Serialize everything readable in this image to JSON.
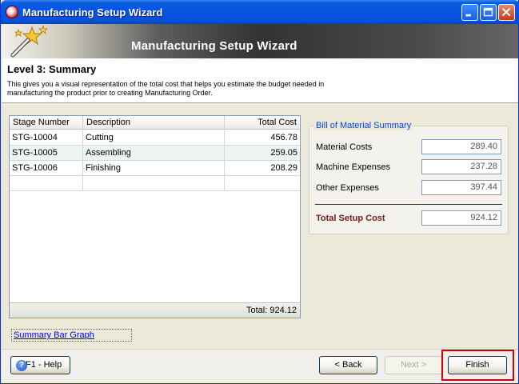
{
  "window": {
    "title": "Manufacturing Setup Wizard"
  },
  "banner": {
    "title": "Manufacturing Setup Wizard"
  },
  "step": {
    "title": "Level 3: Summary",
    "description": "This gives you a visual representation of the total cost that helps you estimate the budget needed in manufacturing the product prior to creating Manufacturing Order."
  },
  "grid": {
    "columns": [
      "Stage Number",
      "Description",
      "Total Cost"
    ],
    "rows": [
      [
        "STG-10004",
        "Cutting",
        "456.78"
      ],
      [
        "STG-10005",
        "Assembling",
        "259.05"
      ],
      [
        "STG-10006",
        "Finishing",
        "208.29"
      ]
    ],
    "total_label": "Total:",
    "total_value": "924.12"
  },
  "bom_summary": {
    "legend": "Bill of Material Summary",
    "material_costs_label": "Material Costs",
    "material_costs_value": "289.40",
    "machine_expenses_label": "Machine Expenses",
    "machine_expenses_value": "237.28",
    "other_expenses_label": "Other Expenses",
    "other_expenses_value": "397.44",
    "total_setup_label": "Total Setup Cost",
    "total_setup_value": "924.12"
  },
  "link": {
    "summary_bar_graph": "Summary Bar Graph"
  },
  "buttons": {
    "help": "F1 - Help",
    "back": "< Back",
    "next": "Next >",
    "finish": "Finish"
  },
  "colors": {
    "titlebar": "#0753E4",
    "accent_link": "#0046D5",
    "total_label": "#7A1919",
    "highlight": "#D00000"
  }
}
